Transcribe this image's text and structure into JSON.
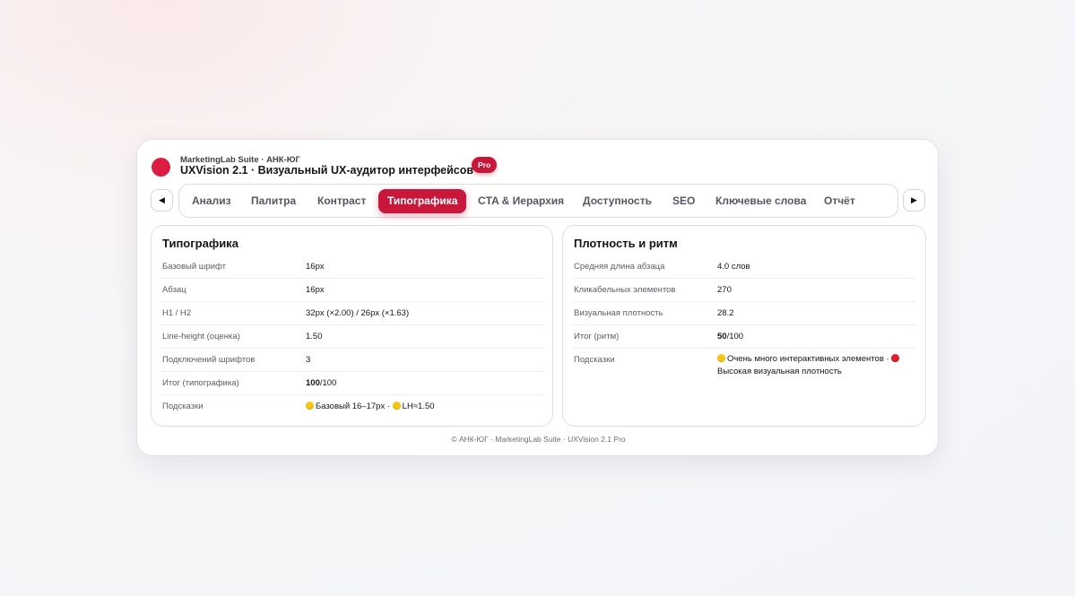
{
  "header": {
    "suite": "MarketingLab Suite · АНК-ЮГ",
    "title": "UXVision 2.1 · Визуальный UX-аудитор интерфейсов",
    "badge": "Pro"
  },
  "nav": {
    "prev_icon": "◀",
    "next_icon": "▶",
    "tabs": [
      {
        "label": "Анализ",
        "active": false
      },
      {
        "label": "Палитра",
        "active": false
      },
      {
        "label": "Контраст",
        "active": false
      },
      {
        "label": "Типографика",
        "active": true
      },
      {
        "label": "CTA & Иерархия",
        "active": false
      },
      {
        "label": "Доступность",
        "active": false
      },
      {
        "label": "SEO",
        "active": false
      },
      {
        "label": "Ключевые слова",
        "active": false
      },
      {
        "label": "Отчёт",
        "active": false
      }
    ]
  },
  "typography": {
    "title": "Типографика",
    "rows": [
      {
        "label": "Базовый шрифт",
        "value": "16px"
      },
      {
        "label": "Абзац",
        "value": "16px"
      },
      {
        "label": "H1 / H2",
        "value": "32px (×2.00) / 26px (×1.63)"
      },
      {
        "label": "Line-height (оценка)",
        "value": "1.50"
      },
      {
        "label": "Подключений шрифтов",
        "value": "3"
      }
    ],
    "score": {
      "label": "Итог (типографика)",
      "value": "100",
      "suffix": "/100"
    },
    "hints": {
      "label": "Подсказки",
      "text1": "Базовый 16–17px ·",
      "text2": "LH≈1.50"
    }
  },
  "density": {
    "title": "Плотность и ритм",
    "rows": [
      {
        "label": "Средняя длина абзаца",
        "value": "4.0 слов"
      },
      {
        "label": "Кликабельных элементов",
        "value": "270"
      },
      {
        "label": "Визуальная плотность",
        "value": "28.2"
      }
    ],
    "score": {
      "label": "Итог (ритм)",
      "value": "50",
      "suffix": "/100"
    },
    "hints": {
      "label": "Подсказки",
      "text1": "Очень много интерактивных элементов ·",
      "text2": "Высокая визуальная плотность"
    }
  },
  "footer": "© АНК-ЮГ · MarketingLab Suite · UXVision 2.1 Pro",
  "colors": {
    "accent": "#c9163b",
    "logo": "#dc1d43",
    "warning": "#f5c518",
    "danger": "#e11d2e"
  }
}
